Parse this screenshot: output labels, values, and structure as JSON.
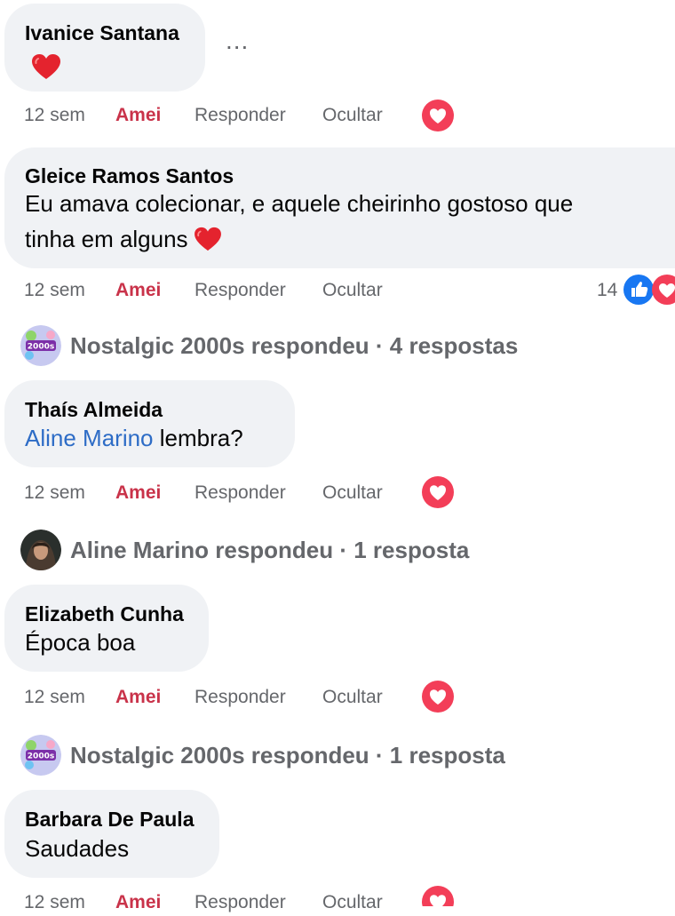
{
  "comments": [
    {
      "author": "Ivanice Santana",
      "text": "",
      "time": "12 sem",
      "love": "Amei",
      "reply": "Responder",
      "hide": "Ocultar",
      "more": "..."
    },
    {
      "author": "Gleice Ramos Santos",
      "text_line1": "Eu amava colecionar, e aquele cheirinho gostoso que",
      "text_line2": "tinha em alguns",
      "time": "12 sem",
      "love": "Amei",
      "reply": "Responder",
      "hide": "Ocultar",
      "reaction_count": "14"
    },
    {
      "replies": "Nostalgic 2000s respondeu · 4 respostas"
    },
    {
      "author": "Thaís Almeida",
      "mention": "Aline Marino",
      "text": " lembra?",
      "time": "12 sem",
      "love": "Amei",
      "reply": "Responder",
      "hide": "Ocultar"
    },
    {
      "replies": "Aline Marino respondeu · 1 resposta"
    },
    {
      "author": "Elizabeth Cunha",
      "text": "Época boa",
      "time": "12 sem",
      "love": "Amei",
      "reply": "Responder",
      "hide": "Ocultar"
    },
    {
      "replies": "Nostalgic 2000s respondeu · 1 resposta"
    },
    {
      "author": "Barbara De Paula",
      "text": "Saudades",
      "time": "12 sem",
      "love": "Amei",
      "reply": "Responder",
      "hide": "Ocultar"
    }
  ],
  "icons": {
    "love_reaction": "heart-reaction-icon",
    "like_reaction": "thumbs-up-icon",
    "heart_emoji": "red-heart-emoji",
    "page_avatar": "nostalgic-2000s-avatar",
    "user_avatar": "aline-marino-avatar"
  },
  "colors": {
    "love": "#c9334a",
    "bubble": "#f0f2f5",
    "meta": "#65676b",
    "mention": "#2d6cc6",
    "like": "#1877f2",
    "heart": "#f33e58"
  }
}
